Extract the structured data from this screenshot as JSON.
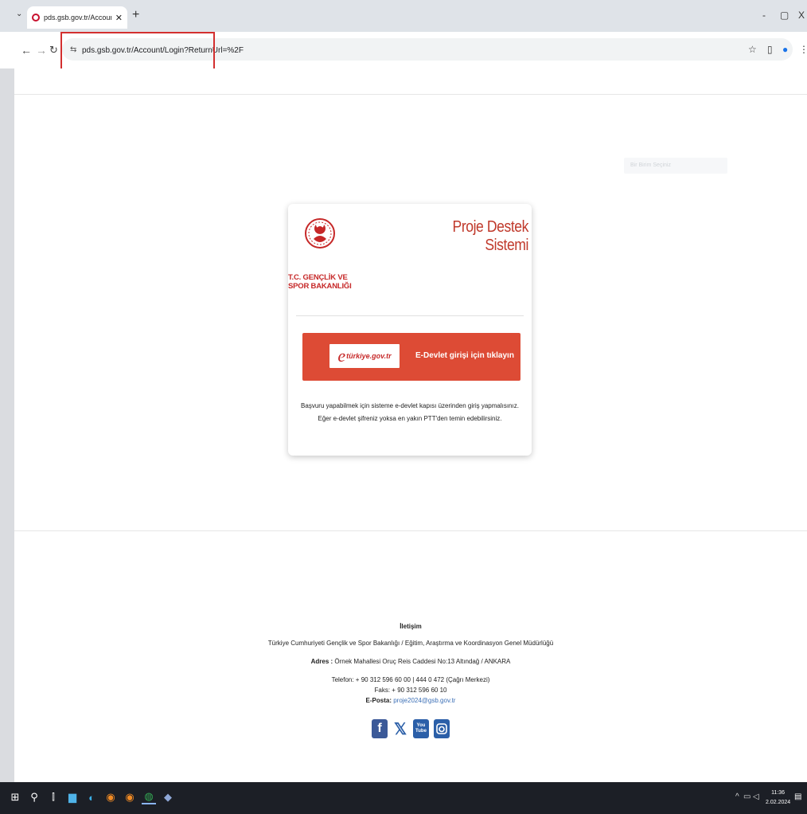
{
  "browser": {
    "tab_title": "pds.gsb.gov.tr/Account/Login?",
    "url": "pds.gsb.gov.tr/Account/Login?ReturnUrl=%2F",
    "window_controls": [
      "-",
      "▢",
      "X"
    ]
  },
  "header": {
    "search_placeholder": "Bir Birim Seçiniz"
  },
  "card": {
    "ministry_line1": "T.C. GENÇLİK VE",
    "ministry_line2": "SPOR BAKANLIĞI",
    "title": "Proje Destek Sistemi",
    "edevlet_logo_text": "türkiye.gov.tr",
    "edevlet_label": "E-Devlet girişi için tıklayın",
    "info_text": "Başvuru yapabilmek için sisteme e-devlet kapısı üzerinden giriş yapmalısınız. Eğer e-devlet şifreniz yoksa en yakın PTT'den temin edebilirsiniz."
  },
  "footer": {
    "heading": "İletişim",
    "org": "Türkiye Cumhuriyeti Gençlik ve Spor Bakanlığı / Eğitim, Araştırma ve Koordinasyon Genel Müdürlüğü",
    "address_label": "Adres :",
    "address": "Örnek Mahallesi Oruç Reis Caddesi No:13 Altındağ / ANKARA",
    "phone": "Telefon: + 90 312 596 60 00 | 444 0 472 (Çağrı Merkezi)",
    "fax": "Faks: + 90 312 596 60 10",
    "email_label": "E-Posta:",
    "email": "proje2024@gsb.gov.tr"
  },
  "social": [
    {
      "name": "facebook",
      "color": "#3b5998",
      "glyph": "f"
    },
    {
      "name": "x",
      "color": "#2b5fa8",
      "glyph": "X"
    },
    {
      "name": "youtube",
      "color": "#2b5fa8",
      "glyph": "You\nTube"
    },
    {
      "name": "instagram",
      "color": "#2b5fa8",
      "glyph": "◙"
    }
  ],
  "taskbar": {
    "time": "11:36",
    "date": "2.02.2024"
  },
  "colors": {
    "brand_red": "#c0392b",
    "button_red": "#dd4b35",
    "link_blue": "#3b6fb6",
    "highlight_red": "#d32f2f"
  }
}
